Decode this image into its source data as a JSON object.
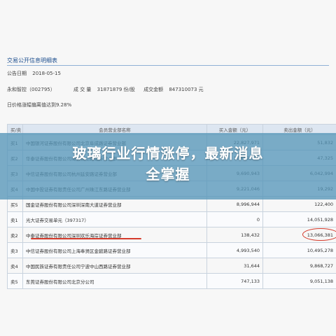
{
  "document": {
    "title": "交易公开信息明细表",
    "announce_date_label": "公告日期",
    "announce_date": "2018-05-15",
    "stock_label": "永和智控（002795）",
    "volume_label": "成 交 量",
    "volume_value": "31871879 份/股",
    "amount_label": "成交金额",
    "amount_value": "847310073 元",
    "note": "日价格涨幅偏离值达到9.28%"
  },
  "table": {
    "headers": [
      "买/卖",
      "会员营业部名称",
      "买入金额（元）",
      "卖出金额（元）"
    ],
    "rows": [
      [
        "买1",
        "中国银河证券股份有限公司北京阜成路证券营业部",
        "22,827,971",
        "51,832"
      ],
      [
        "买2",
        "华泰证券股份有限公司南京长江路证券营业部",
        "11,882,300",
        "47,325"
      ],
      [
        "买3",
        "中信证券股份有限公司杭州延安路证券营业部",
        "9,690,943",
        "6,042,994"
      ],
      [
        "买4",
        "中国中投证券有限责任公司广州珠江东路证券营业部",
        "9,221,046",
        "19,292"
      ],
      [
        "买5",
        "国金证券股份有限公司深圳深南大道证券营业部",
        "8,996,944",
        "122,400"
      ],
      [
        "卖1",
        "光大证券交易单元（397317）",
        "0",
        "14,051,928"
      ],
      [
        "卖2",
        "中泰证券股份有限公司深圳欢乐海岸证券营业部",
        "138,432",
        "13,066,381"
      ],
      [
        "卖3",
        "中信证券股份有限公司上海奉贤区金碧路证券营业部",
        "4,993,540",
        "10,495,278"
      ],
      [
        "卖4",
        "中国民族证券有限责任公司宁波中山西路证券营业部",
        "31,644",
        "9,868,727"
      ],
      [
        "卖5",
        "东莞证券股份有限公司北京分公司",
        "747,133",
        "9,051,138"
      ]
    ]
  },
  "banner": {
    "line1": "玻璃行业行情涨停，最新消息",
    "line2": "全掌握"
  },
  "colors": {
    "banner": "#5696b9",
    "highlight": "#d43a2b",
    "header_bg": "#dde6f1"
  }
}
